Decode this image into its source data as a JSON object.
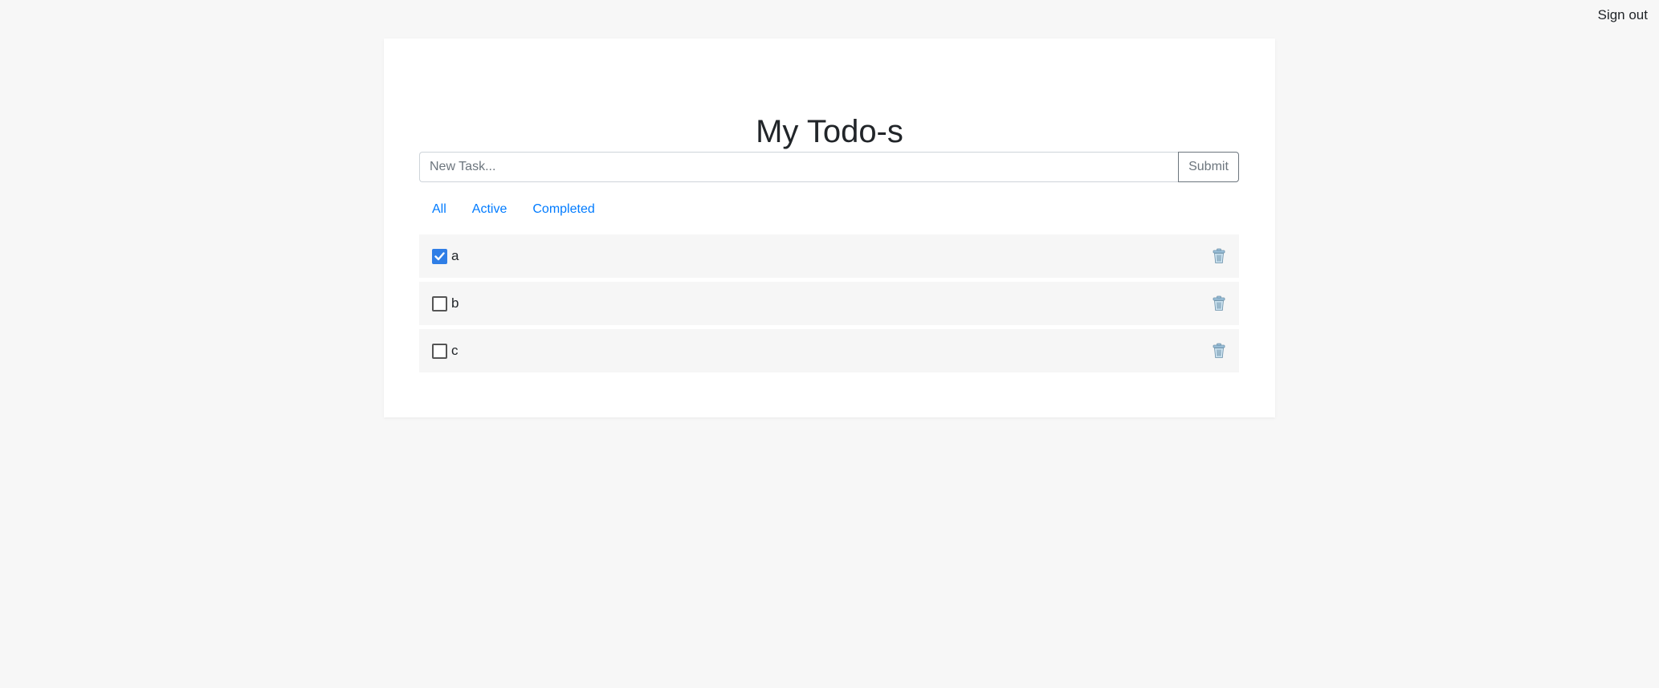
{
  "header": {
    "signout_label": "Sign out"
  },
  "main": {
    "title": "My Todo-s",
    "input_placeholder": "New Task...",
    "input_value": "",
    "submit_label": "Submit",
    "filters": [
      "All",
      "Active",
      "Completed"
    ],
    "items": [
      {
        "label": "a",
        "completed": true
      },
      {
        "label": "b",
        "completed": false
      },
      {
        "label": "c",
        "completed": false
      }
    ]
  },
  "colors": {
    "accent": "#007bff",
    "checkbox_checked": "#2f7ee6",
    "background": "#f7f7f7",
    "item_background": "#f6f6f6"
  },
  "icons": {
    "delete": "trash-icon",
    "check": "check-icon"
  }
}
